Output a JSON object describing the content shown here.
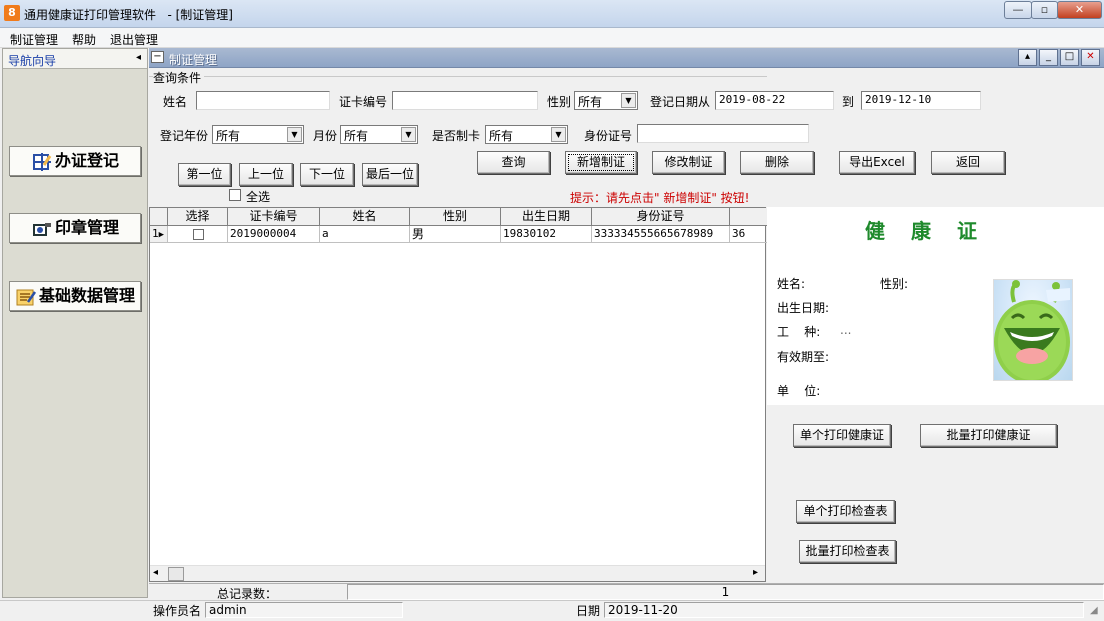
{
  "window": {
    "app_icon": "8",
    "title": "通用健康证打印管理软件   - [制证管理]",
    "minimize": "—",
    "maximize": "▫",
    "close": "✕"
  },
  "menu": [
    "制证管理",
    "帮助",
    "退出管理"
  ],
  "nav": {
    "header": "导航向导",
    "collapse": "◂",
    "buttons": [
      "办证登记",
      "印章管理",
      "基础数据管理"
    ]
  },
  "inner_window": {
    "title": "制证管理",
    "icon": "−",
    "controls": [
      "▴",
      "_",
      "□",
      "✕"
    ]
  },
  "query": {
    "legend": "查询条件",
    "name_label": "姓名",
    "name_value": "",
    "card_no_label": "证卡编号",
    "card_no_value": "",
    "gender_label": "性别",
    "gender_value": "所有",
    "date_from_label": "登记日期从",
    "date_from": "2019-08-22",
    "date_to_label": "到",
    "date_to": "2019-12-10",
    "year_label": "登记年份",
    "year_value": "所有",
    "month_label": "月份",
    "month_value": "所有",
    "made_label": "是否制卡",
    "made_value": "所有",
    "id_label": "身份证号",
    "id_value": ""
  },
  "nav_buttons": [
    "第一位",
    "上一位",
    "下一位",
    "最后一位"
  ],
  "action_buttons": [
    "查询",
    "新增制证",
    "修改制证",
    "删除",
    "导出Excel",
    "返回"
  ],
  "select_all": "全选",
  "hint": "提示：请先点击\" 新增制证\" 按钮!",
  "grid": {
    "columns": [
      "选择",
      "证卡编号",
      "姓名",
      "性别",
      "出生日期",
      "身份证号",
      ""
    ],
    "rows": [
      {
        "index": "1",
        "card_no": "2019000004",
        "name": "a",
        "gender": "男",
        "birth": "19830102",
        "id": "333334555665678989",
        "extra": "36"
      }
    ],
    "scroll_left": "◂",
    "scroll_right": "▸"
  },
  "card": {
    "title": "健康证",
    "name_label": "姓名:",
    "gender_label": "性别:",
    "birth_label": "出生日期:",
    "job_label": "工    种:",
    "job_value": "...",
    "valid_label": "有效期至:",
    "unit_label": "单    位:"
  },
  "print_buttons": [
    "单个打印健康证",
    "批量打印健康证",
    "单个打印检查表",
    "批量打印检查表"
  ],
  "status": {
    "total_label": "总记录数：",
    "total_value": "1",
    "operator_label": "操作员名",
    "operator_value": "admin",
    "date_label": "日期",
    "date_value": "2019-11-20"
  }
}
